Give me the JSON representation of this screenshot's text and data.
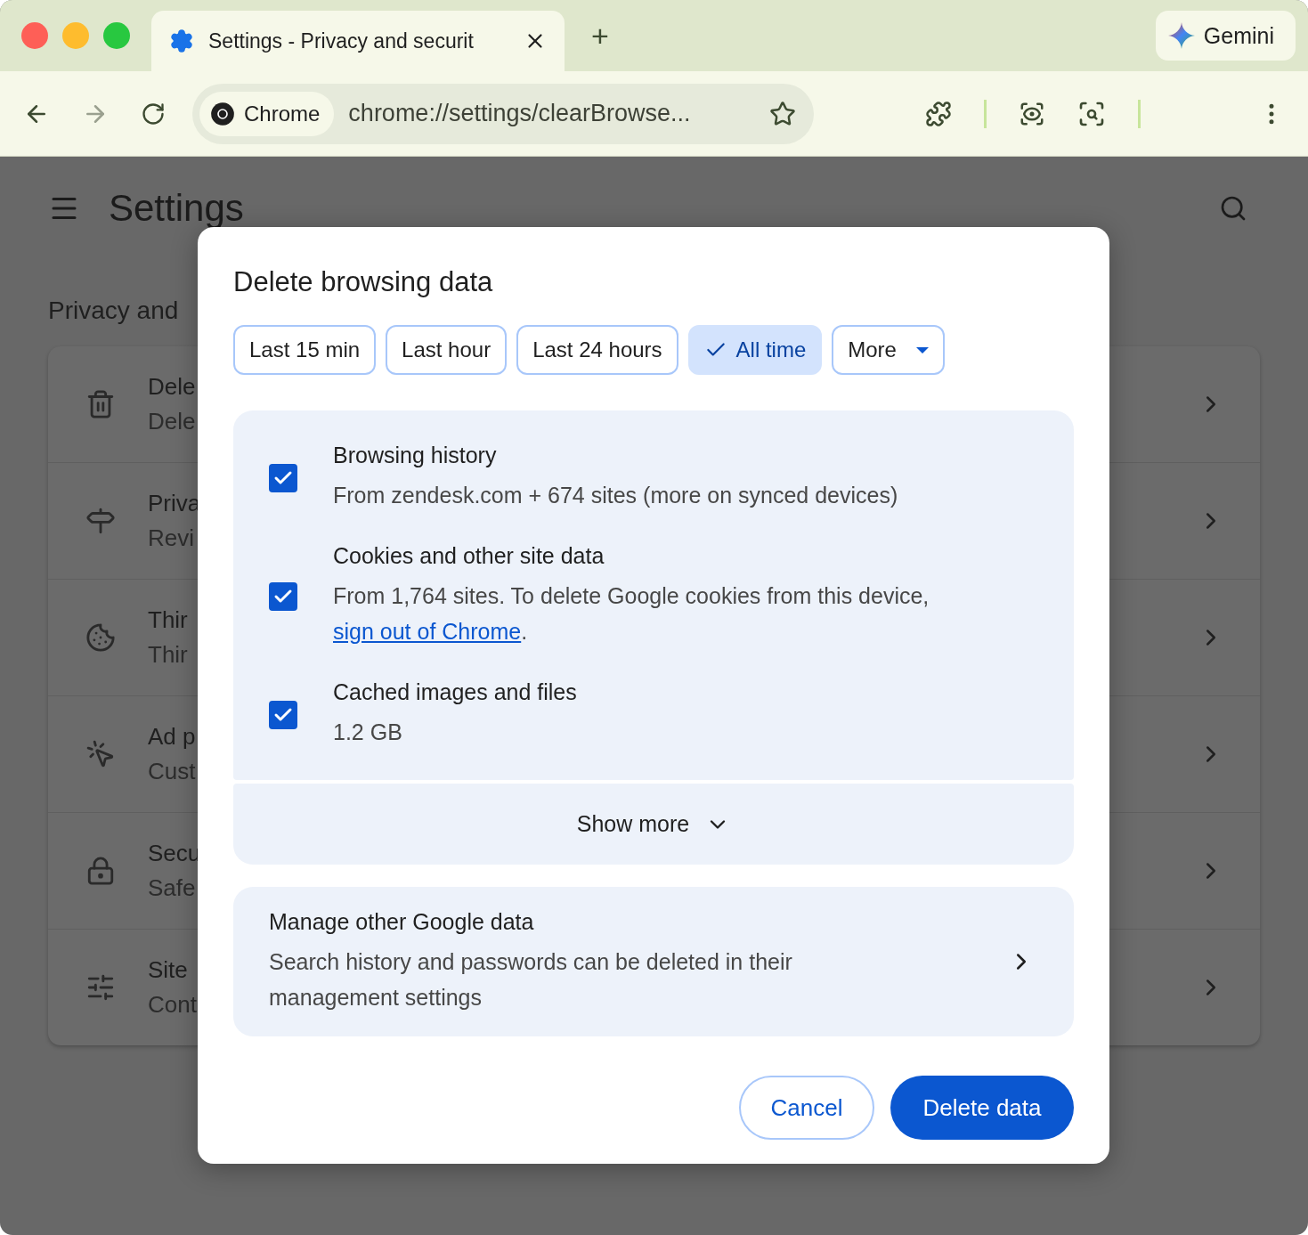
{
  "browser": {
    "tab_title": "Settings - Privacy and securit",
    "new_tab": "+",
    "gemini": "Gemini",
    "chip_label": "Chrome",
    "url": "chrome://settings/clearBrowse..."
  },
  "settings": {
    "title": "Settings",
    "section": "Privacy and",
    "rows": [
      {
        "kind": "trash",
        "title": "Dele",
        "subtitle": "Dele"
      },
      {
        "kind": "signpost",
        "title": "Priva",
        "subtitle": "Revi"
      },
      {
        "kind": "cookie",
        "title": "Thir",
        "subtitle": "Thir"
      },
      {
        "kind": "target",
        "title": "Ad p",
        "subtitle": "Cust"
      },
      {
        "kind": "lock",
        "title": "Secu",
        "subtitle": "Safe"
      },
      {
        "kind": "sliders",
        "title": "Site",
        "subtitle": "Cont"
      }
    ]
  },
  "dialog": {
    "title": "Delete browsing data",
    "ranges": [
      {
        "kind": "range",
        "label": "Last 15 min",
        "selected": false
      },
      {
        "kind": "range",
        "label": "Last hour",
        "selected": false
      },
      {
        "kind": "range",
        "label": "Last 24 hours",
        "selected": false
      },
      {
        "kind": "range",
        "label": "All time",
        "selected": true
      },
      {
        "kind": "menu",
        "label": "More",
        "selected": false
      }
    ],
    "items": [
      {
        "title": "Browsing history",
        "description": "From zendesk.com + 674 sites (more on synced devices)",
        "checked": true
      },
      {
        "title": "Cookies and other site data",
        "description": "From 1,764 sites. To delete Google cookies from this device,",
        "link": "sign out of Chrome",
        "link_suffix": ".",
        "checked": true
      },
      {
        "title": "Cached images and files",
        "description": "1.2 GB",
        "checked": true
      }
    ],
    "show_more": "Show more",
    "manage": {
      "title": "Manage other Google data",
      "description": "Search history and passwords can be deleted in their management settings"
    },
    "cancel": "Cancel",
    "confirm": "Delete data"
  }
}
